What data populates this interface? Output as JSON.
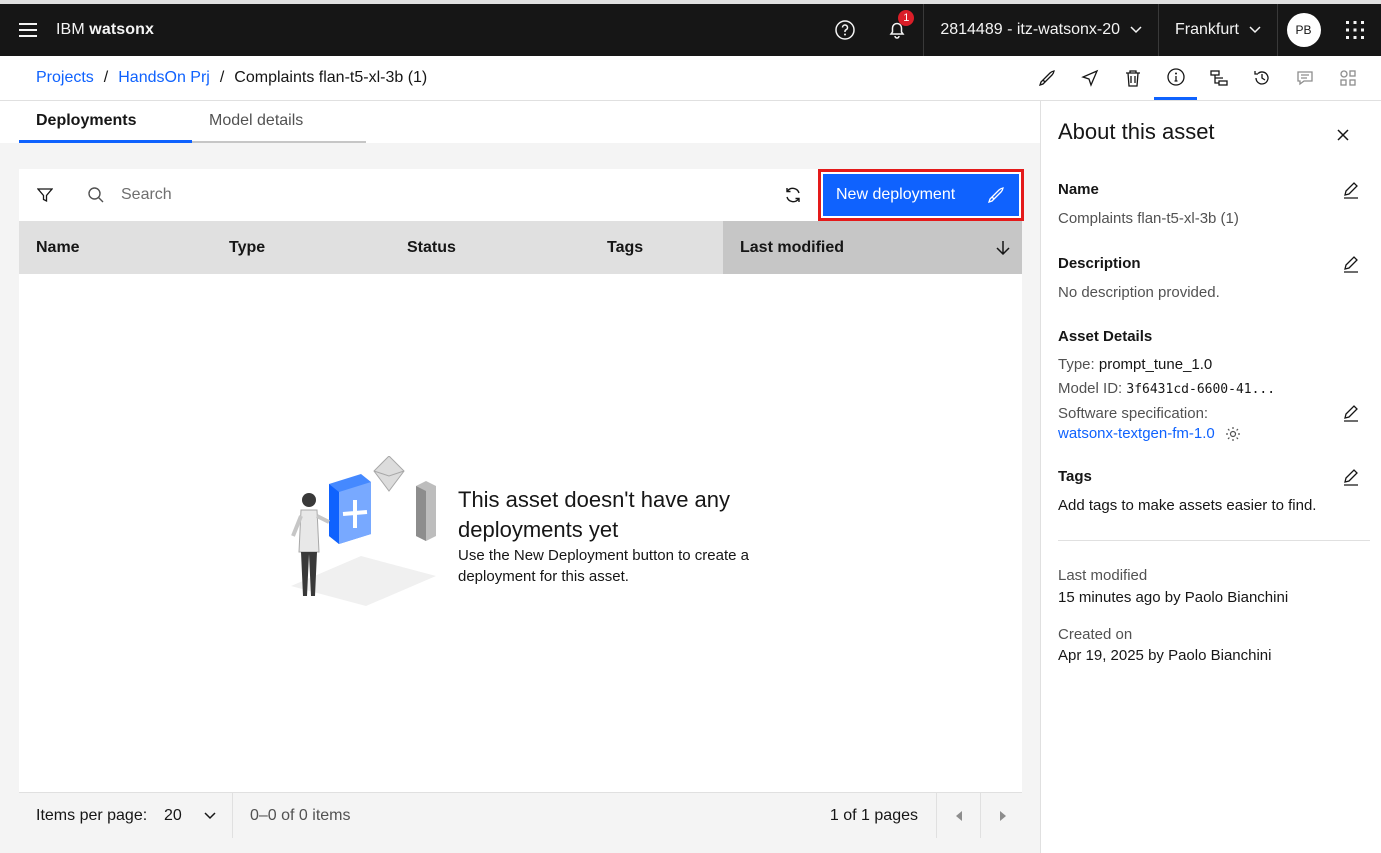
{
  "header": {
    "brand_prefix": "IBM",
    "brand_name": "watsonx",
    "notification_count": "1",
    "account": "2814489 - itz-watsonx-20",
    "region": "Frankfurt",
    "avatar_initials": "PB"
  },
  "breadcrumb": {
    "items": [
      "Projects",
      "HandsOn Prj"
    ],
    "current": "Complaints flan-t5-xl-3b (1)",
    "separator": "/"
  },
  "tabs": [
    "Deployments",
    "Model details"
  ],
  "table": {
    "search_placeholder": "Search",
    "new_deployment_label": "New deployment",
    "columns": [
      "Name",
      "Type",
      "Status",
      "Tags",
      "Last modified"
    ],
    "empty_title": "This asset doesn't have any deployments yet",
    "empty_description": "Use the New Deployment button to create a deployment for this asset."
  },
  "pagination": {
    "items_per_page_label": "Items per page:",
    "items_per_page_value": "20",
    "range_text": "0–0 of 0 items",
    "pages_text": "1 of 1 pages"
  },
  "panel": {
    "title": "About this asset",
    "name_label": "Name",
    "name_value": "Complaints flan-t5-xl-3b (1)",
    "description_label": "Description",
    "description_value": "No description provided.",
    "asset_details_label": "Asset Details",
    "type_key": "Type:",
    "type_value": "prompt_tune_1.0",
    "model_id_key": "Model ID:",
    "model_id_value": "3f6431cd-6600-41...",
    "software_spec_key": "Software specification:",
    "software_spec_value": "watsonx-textgen-fm-1.0",
    "tags_label": "Tags",
    "tags_value": "Add tags to make assets easier to find.",
    "last_modified_label": "Last modified",
    "last_modified_value": "15 minutes ago by Paolo Bianchini",
    "created_label": "Created on",
    "created_value": "Apr 19, 2025 by Paolo Bianchini"
  },
  "colors": {
    "header_bg": "#161616",
    "primary": "#0f62fe",
    "highlight_border": "#e41a1a",
    "badge": "#da1e28"
  }
}
